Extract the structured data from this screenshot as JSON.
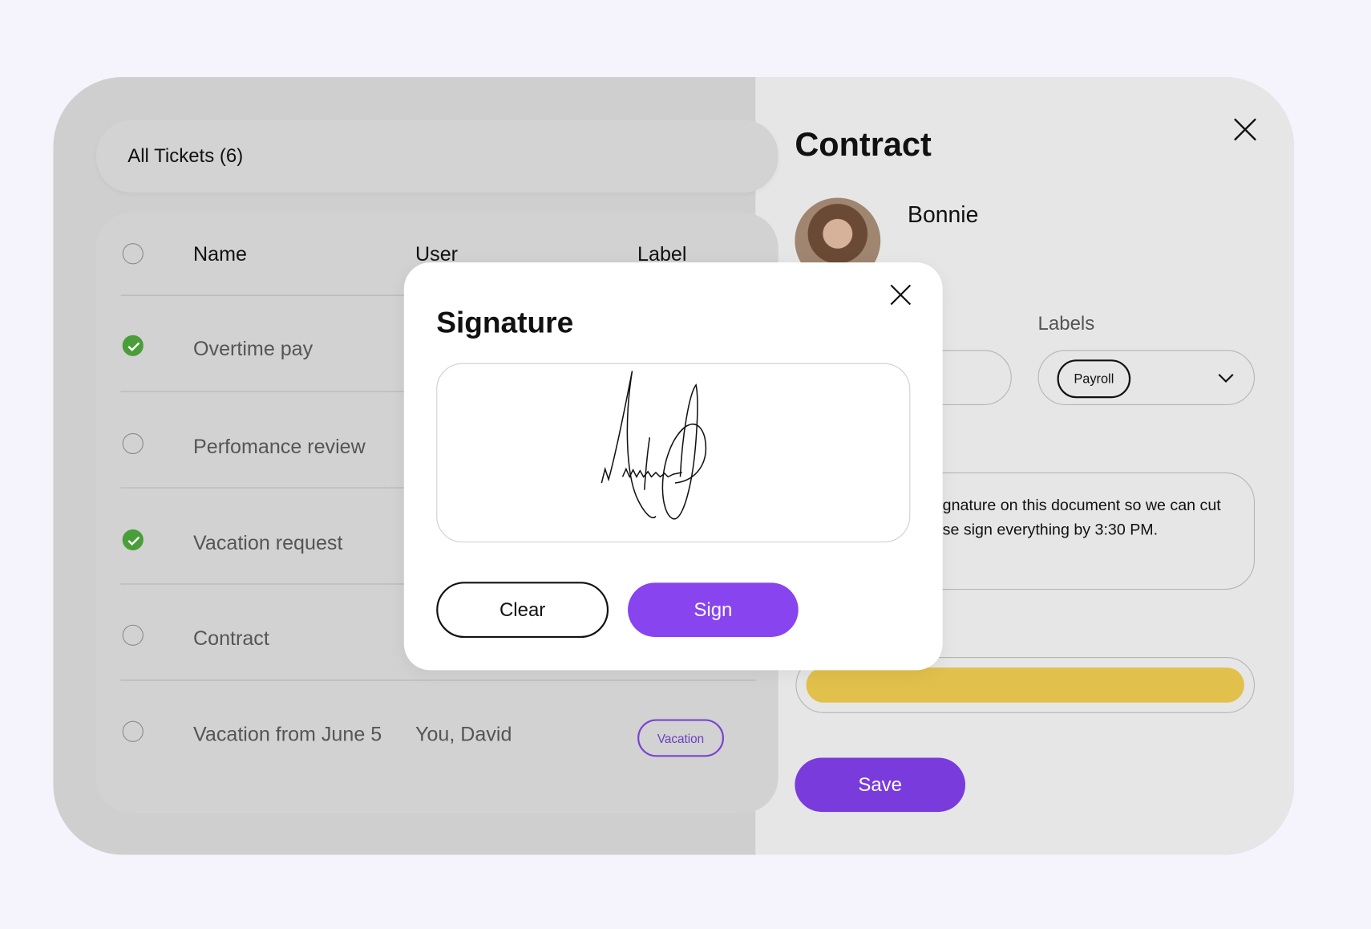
{
  "tickets": {
    "header": "All Tickets (6)",
    "columns": [
      "Name",
      "User",
      "Label"
    ],
    "rows": [
      {
        "name": "Overtime pay",
        "checked": true
      },
      {
        "name": "Perfomance review",
        "checked": false
      },
      {
        "name": "Vacation request",
        "checked": true
      },
      {
        "name": "Contract",
        "checked": false
      },
      {
        "name": "Vacation from June 5",
        "user": "You, David",
        "label": "Vacation",
        "checked": false
      }
    ]
  },
  "panel": {
    "title": "Contract",
    "user_name": "Bonnie",
    "labels_label": "Labels",
    "selected_label": "Payroll",
    "message_line1": "gnature on this document so we can cut",
    "message_line2": "se sign everything by 3:30 PM.",
    "progress_percent": 100,
    "save_label": "Save"
  },
  "modal": {
    "title": "Signature",
    "clear_label": "Clear",
    "sign_label": "Sign"
  },
  "colors": {
    "accent": "#8844ee",
    "save": "#7a3bdc",
    "progress": "#e2c04c",
    "check": "#4a9e3a",
    "badge": "#7a45d0"
  }
}
